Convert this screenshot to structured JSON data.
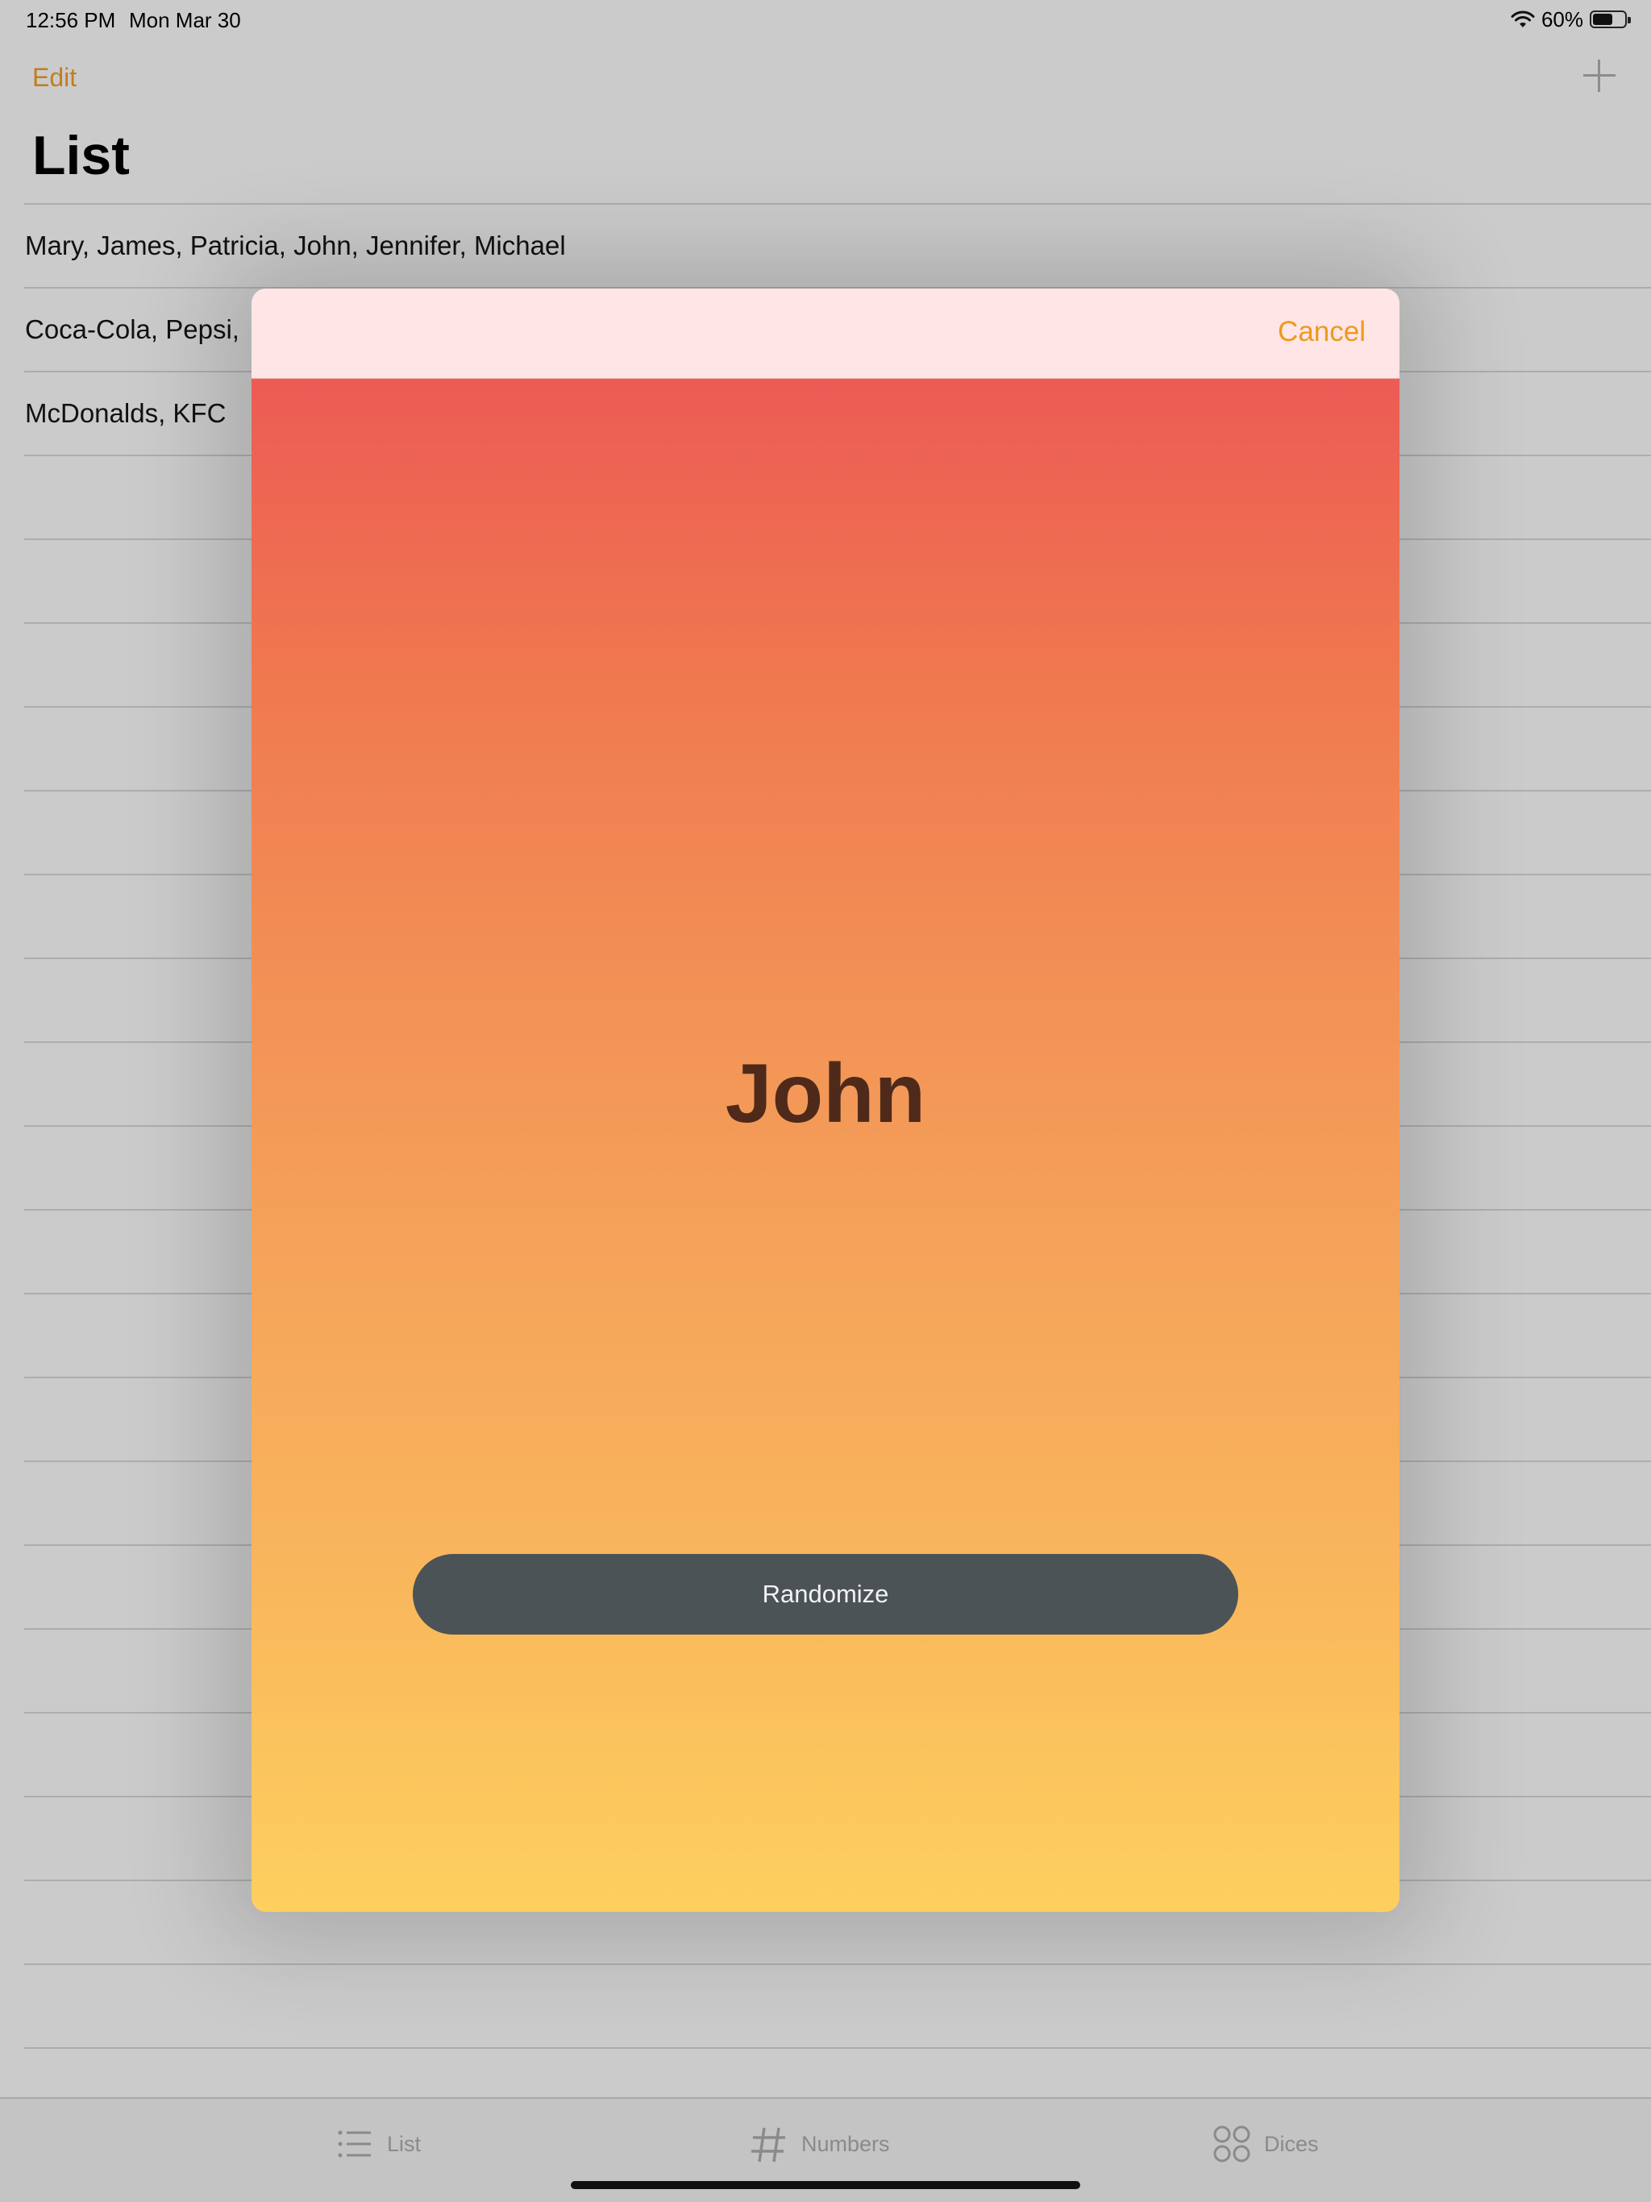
{
  "status_bar": {
    "time": "12:56 PM",
    "date": "Mon Mar 30",
    "battery": "60%",
    "battery_level": 0.6
  },
  "nav": {
    "edit_label": "Edit",
    "add_icon": "plus-icon",
    "title": "List"
  },
  "lists": [
    "Mary, James, Patricia, John, Jennifer, Michael",
    "Coca-Cola, Pepsi,",
    "McDonalds, KFC"
  ],
  "modal": {
    "cancel_label": "Cancel",
    "result": "John",
    "randomize_label": "Randomize",
    "gradient_top": "#ec5b55",
    "gradient_bottom": "#fdd05e",
    "header_color": "#ffe5e5"
  },
  "tabs": [
    {
      "label": "List",
      "icon": "list-icon"
    },
    {
      "label": "Numbers",
      "icon": "hash-icon"
    },
    {
      "label": "Dices",
      "icon": "grid-icon"
    }
  ],
  "colors": {
    "accent": "#ec9a1f",
    "edit": "#c27e1e",
    "button": "#4c5357"
  }
}
